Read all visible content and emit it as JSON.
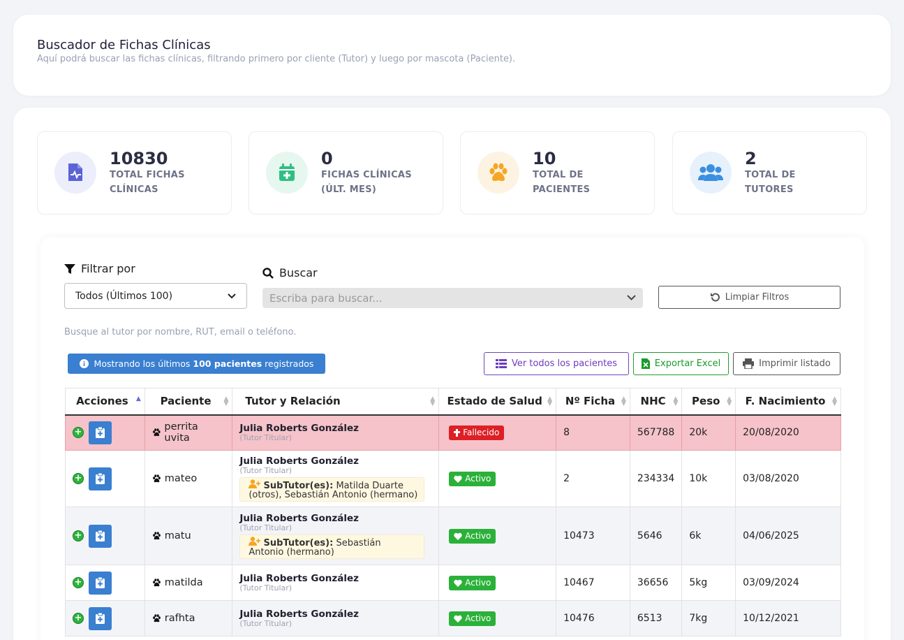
{
  "header": {
    "title": "Buscador de Fichas Clínicas",
    "subtitle": "Aquí podrá buscar las fichas clínicas, filtrando primero por cliente (Tutor) y luego por mascota (Paciente)."
  },
  "stats": [
    {
      "value": "10830",
      "label": "TOTAL FICHAS CLÍNICAS",
      "icon": "file-medical-icon",
      "color": "#5b63d6",
      "bg": "#eceefb"
    },
    {
      "value": "0",
      "label": "FICHAS CLÍNICAS (ÚLT. MES)",
      "icon": "calendar-plus-icon",
      "color": "#2fbf83",
      "bg": "#e6f7ef"
    },
    {
      "value": "10",
      "label": "TOTAL DE PACIENTES",
      "icon": "paw-icon",
      "color": "#f5a623",
      "bg": "#fdf3e3"
    },
    {
      "value": "2",
      "label": "TOTAL DE TUTORES",
      "icon": "users-icon",
      "color": "#3a8fe0",
      "bg": "#e7f1fc"
    }
  ],
  "filters": {
    "filter_label": "Filtrar por",
    "filter_value": "Todos (Últimos 100)",
    "search_label": "Buscar",
    "search_placeholder": "Escriba para buscar...",
    "clear_label": "Limpiar Filtros",
    "hint": "Busque al tutor por nombre, RUT, email o teléfono."
  },
  "info": {
    "prefix": "Mostrando los últimos",
    "bold": "100 pacientes",
    "suffix": "registrados"
  },
  "actions": {
    "view_all": "Ver todos los pacientes",
    "export": "Exportar Excel",
    "print": "Imprimir listado"
  },
  "table": {
    "columns": [
      "Acciones",
      "Paciente",
      "Tutor y Relación",
      "Estado de Salud",
      "Nº Ficha",
      "NHC",
      "Peso",
      "F. Nacimiento"
    ],
    "rows": [
      {
        "paciente": "perrita uvita",
        "tutor": "Julia Roberts González",
        "relacion": "(Tutor Titular)",
        "subtutor_label": "",
        "subtutor": "",
        "estado": "Fallecido",
        "ficha": "8",
        "nhc": "567788",
        "peso": "20k",
        "nacimiento": "20/08/2020"
      },
      {
        "paciente": "mateo",
        "tutor": "Julia Roberts González",
        "relacion": "(Tutor Titular)",
        "subtutor_label": "SubTutor(es):",
        "subtutor": "Matilda Duarte (otros), Sebastián Antonio (hermano)",
        "estado": "Activo",
        "ficha": "2",
        "nhc": "234334",
        "peso": "10k",
        "nacimiento": "03/08/2020"
      },
      {
        "paciente": "matu",
        "tutor": "Julia Roberts González",
        "relacion": "(Tutor Titular)",
        "subtutor_label": "SubTutor(es):",
        "subtutor": "Sebastián Antonio (hermano)",
        "estado": "Activo",
        "ficha": "10473",
        "nhc": "5646",
        "peso": "6k",
        "nacimiento": "04/06/2025"
      },
      {
        "paciente": "matilda",
        "tutor": "Julia Roberts González",
        "relacion": "(Tutor Titular)",
        "subtutor_label": "",
        "subtutor": "",
        "estado": "Activo",
        "ficha": "10467",
        "nhc": "36656",
        "peso": "5kg",
        "nacimiento": "03/09/2024"
      },
      {
        "paciente": "rafhta",
        "tutor": "Julia Roberts González",
        "relacion": "(Tutor Titular)",
        "subtutor_label": "",
        "subtutor": "",
        "estado": "Activo",
        "ficha": "10476",
        "nhc": "6513",
        "peso": "7kg",
        "nacimiento": "10/12/2021"
      }
    ]
  }
}
